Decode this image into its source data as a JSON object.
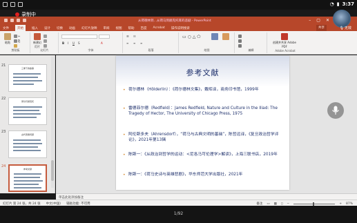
{
  "status": {
    "time": "3:37",
    "recording_label": "录制中"
  },
  "window": {
    "title": "从荷德林到…从荷马到赫克托耳的悲剧 - PowerPoint",
    "mute_label": "无效"
  },
  "ribbon_tabs": [
    "文件",
    "开始",
    "插入",
    "设计",
    "切换",
    "动画",
    "幻灯片放映",
    "审阅",
    "视图",
    "帮助",
    "百度",
    "Acrobat",
    "操作说明搜索"
  ],
  "ribbon": {
    "paste_label": "粘贴",
    "new_slide_label": "新建幻灯片",
    "groups": [
      "剪贴板",
      "幻灯片",
      "字体",
      "段落",
      "绘图",
      "编辑",
      "Adobe Acrobat"
    ],
    "acrobat_label": "创建并共享 Adobe PDF",
    "share_label": "共享"
  },
  "thumbnails": [
    {
      "num": "21",
      "title": "三重下的故事"
    },
    {
      "num": "22",
      "title": "荷马与赫克托"
    },
    {
      "num": "23",
      "title": "古代悲剧问题"
    },
    {
      "num": "24",
      "title": "参考文献"
    }
  ],
  "slide": {
    "title": "参考文献",
    "references": [
      {
        "text": "荷尔德林（Hölderlin）：《荷尔德林文集》，戴晖译，商务印书馆，1999年"
      },
      {
        "text": "雷德菲尔德（Redfield）：James Redfield, Nature and Culture in the Iliad: The Tragedy of Hector, The University of Chicago Press, 1975"
      },
      {
        "text": "阿伦斯多夫（Ahrensdorf），“荷马与古典文明的基础”，陈哲远译，《复旦政治哲学评论》，2021年第13辑"
      },
      {
        "text": "陈斯一：《从政治到哲学的运动：<尼各马可伦理学>解读》，上海三联书店，2019年"
      },
      {
        "text": "陈斯一：《荷马史诗与英雄悲剧》，华东师范大学出版社，2021年"
      }
    ]
  },
  "notes_placeholder": "单击此处添加备注",
  "ppt_status": {
    "slide_info": "幻灯片 第 24 张，共 24 张",
    "language": "中文(中国)",
    "accessibility": "辅助功能: 不可用",
    "notes": "备注",
    "zoom": "87%"
  },
  "pager": "1/92"
}
